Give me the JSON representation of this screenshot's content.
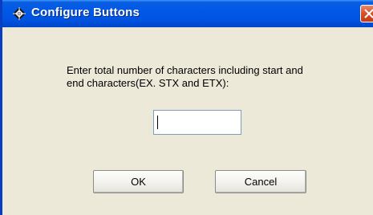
{
  "window": {
    "title": "Configure Buttons",
    "icon": "diamond-app-icon",
    "close_icon": "close-icon",
    "titlebar_color": "#0054e3",
    "close_color": "#d9532a"
  },
  "dialog": {
    "prompt": "Enter total number of characters including start and\nend characters(EX.  STX and ETX):",
    "input_value": "",
    "ok_label": "OK",
    "cancel_label": "Cancel"
  }
}
